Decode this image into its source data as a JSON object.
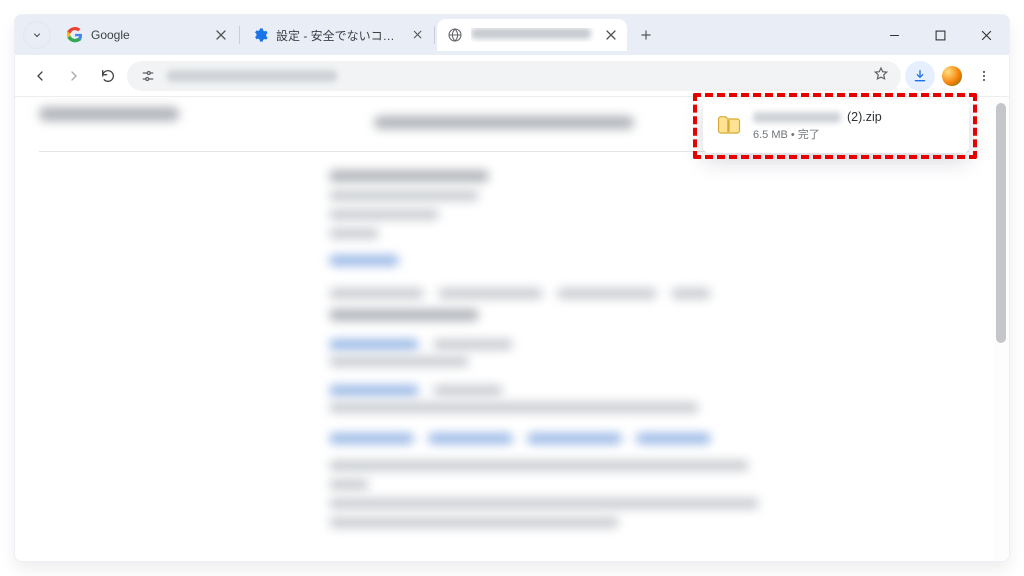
{
  "tabs": [
    {
      "title": "Google",
      "favicon": "google"
    },
    {
      "title": "設定 - 安全でないコンテンツ",
      "favicon": "gear"
    },
    {
      "title": "",
      "favicon": "globe",
      "active": true,
      "blurred": true
    }
  ],
  "download": {
    "filename_suffix": "(2).zip",
    "status": "6.5 MB • 完了"
  },
  "icons": {
    "caret": "chevron-down",
    "newtab": "plus",
    "min": "minimize",
    "max": "maximize",
    "close": "close"
  }
}
